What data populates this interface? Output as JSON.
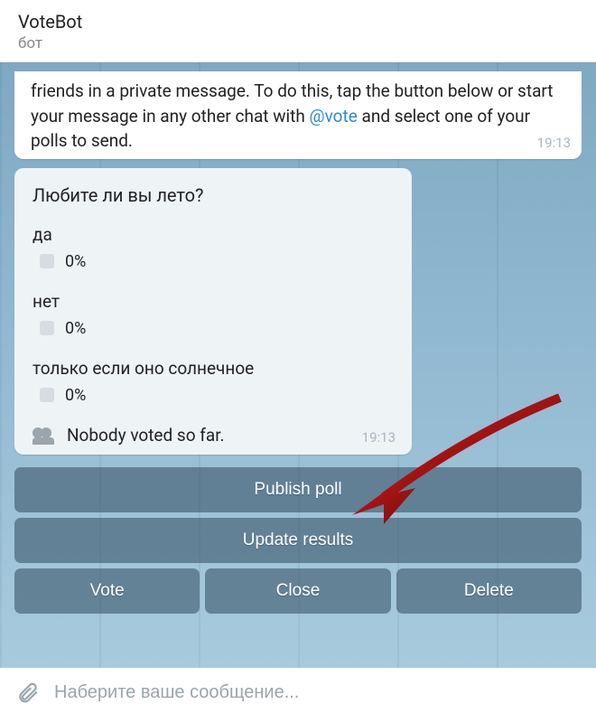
{
  "header": {
    "title": "VoteBot",
    "subtitle": "бот"
  },
  "intro": {
    "text_prefix": "friends in a private message. To do this, tap the button below or start your message in any other chat with ",
    "mention": "@vote",
    "text_suffix": " and select one of your polls to send.",
    "time": "19:13"
  },
  "poll": {
    "title": "Любите ли вы лето?",
    "options": [
      {
        "label": "да",
        "percent": "0%"
      },
      {
        "label": "нет",
        "percent": "0%"
      },
      {
        "label": "только если оно солнечное",
        "percent": "0%"
      }
    ],
    "footer": "Nobody voted so far.",
    "time": "19:13"
  },
  "buttons": {
    "publish": "Publish poll",
    "update": "Update results",
    "vote": "Vote",
    "close": "Close",
    "delete": "Delete"
  },
  "input": {
    "placeholder": "Наберите ваше сообщение..."
  }
}
